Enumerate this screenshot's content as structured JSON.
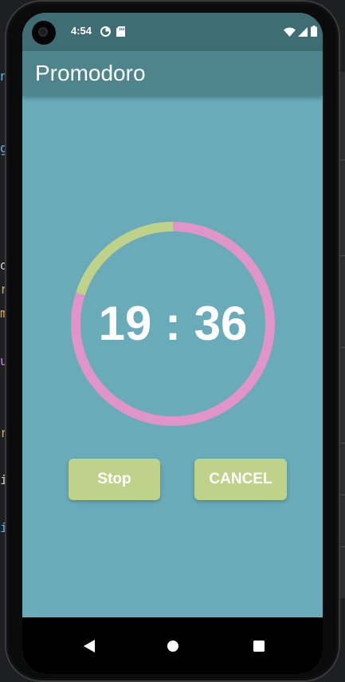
{
  "status_bar": {
    "time": "4:54"
  },
  "app_bar": {
    "title": "Promodoro"
  },
  "timer": {
    "display": "19 : 36",
    "progress_fraction": 0.2
  },
  "buttons": {
    "stop_label": "Stop",
    "cancel_label": "CANCEL"
  },
  "colors": {
    "background": "#69abb8",
    "app_bar": "#4e858d",
    "status_bar": "#3f6d74",
    "ring_remaining": "#e094c8",
    "ring_elapsed": "#bfd28a",
    "button": "#bfd28a"
  },
  "icons": {
    "status_left": [
      "dnd-icon",
      "sd-card-icon"
    ],
    "status_right": [
      "wifi-icon",
      "signal-icon",
      "battery-icon"
    ],
    "nav": [
      "back-icon",
      "home-icon",
      "recents-icon"
    ]
  },
  "background_code_chars": [
    "n",
    "g",
    "d",
    "r",
    "m",
    "u",
    "r",
    "i",
    "i"
  ]
}
